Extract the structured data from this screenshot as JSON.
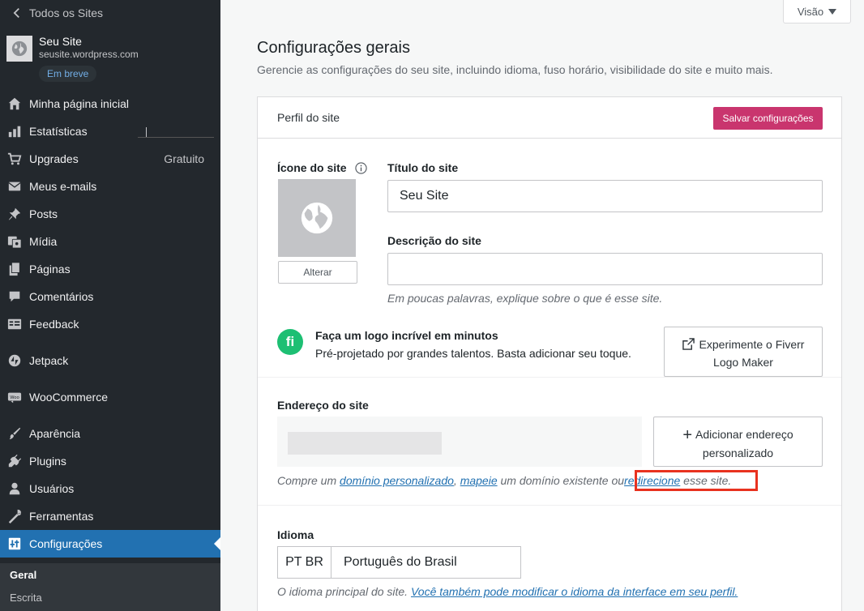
{
  "sidebar": {
    "back_label": "Todos os Sites",
    "site": {
      "name": "Seu Site",
      "url": "seusite.wordpress.com",
      "badge": "Em breve"
    },
    "items": [
      {
        "label": "Minha página inicial",
        "icon": "home-icon"
      },
      {
        "label": "Estatísticas",
        "icon": "stats-icon"
      },
      {
        "label": "Upgrades",
        "icon": "cart-icon",
        "aside": "Gratuito"
      },
      {
        "label": "Meus e-mails",
        "icon": "mail-icon"
      },
      {
        "label": "Posts",
        "icon": "pin-icon"
      },
      {
        "label": "Mídia",
        "icon": "media-icon"
      },
      {
        "label": "Páginas",
        "icon": "pages-icon"
      },
      {
        "label": "Comentários",
        "icon": "comment-icon"
      },
      {
        "label": "Feedback",
        "icon": "feedback-icon"
      },
      {
        "label": "Jetpack",
        "icon": "jetpack-icon"
      },
      {
        "label": "WooCommerce",
        "icon": "woo-icon"
      },
      {
        "label": "Aparência",
        "icon": "brush-icon"
      },
      {
        "label": "Plugins",
        "icon": "plugin-icon"
      },
      {
        "label": "Usuários",
        "icon": "user-icon"
      },
      {
        "label": "Ferramentas",
        "icon": "wrench-icon"
      },
      {
        "label": "Configurações",
        "icon": "settings-icon"
      }
    ],
    "submenu": [
      "Geral",
      "Escrita"
    ]
  },
  "header": {
    "view_button": "Visão",
    "title": "Configurações gerais",
    "subtitle": "Gerencie as configurações do seu site, incluindo idioma, fuso horário, visibilidade do site e muito mais."
  },
  "card": {
    "heading": "Perfil do site",
    "save_label": "Salvar configurações",
    "site_icon_label": "Ícone do site",
    "change_label": "Alterar",
    "title_label": "Título do site",
    "title_value": "Seu Site",
    "description_label": "Descrição do site",
    "description_value": "",
    "description_hint": "Em poucas palavras, explique sobre o que é esse site.",
    "fiverr": {
      "logo": "fi",
      "title": "Faça um logo incrível em minutos",
      "desc": "Pré-projetado por grandes talentos. Basta adicionar seu toque.",
      "button_line1": "Experimente o Fiverr",
      "button_line2": "Logo Maker"
    },
    "address": {
      "label": "Endereço do site",
      "add_line1": "Adicionar endereço",
      "add_line2": "personalizado",
      "hint_prefix": "Compre um ",
      "link_buy": "domínio personalizado",
      "sep": ", ",
      "link_map": "mapeie",
      "hint_mid": " um domínio existente ou",
      "link_redirect": "redirecione",
      "hint_end": " esse site."
    },
    "language": {
      "label": "Idioma",
      "code": "PT BR",
      "name": "Português do Brasil",
      "hint": "O idioma principal do site. ",
      "link": "Você também pode modificar o idioma da interface em seu perfil."
    }
  },
  "colors": {
    "sidebar": "#23282d",
    "active": "#2271b1",
    "save": "#c9356e",
    "fiverr": "#1dbf73",
    "highlight": "#e8321f"
  }
}
